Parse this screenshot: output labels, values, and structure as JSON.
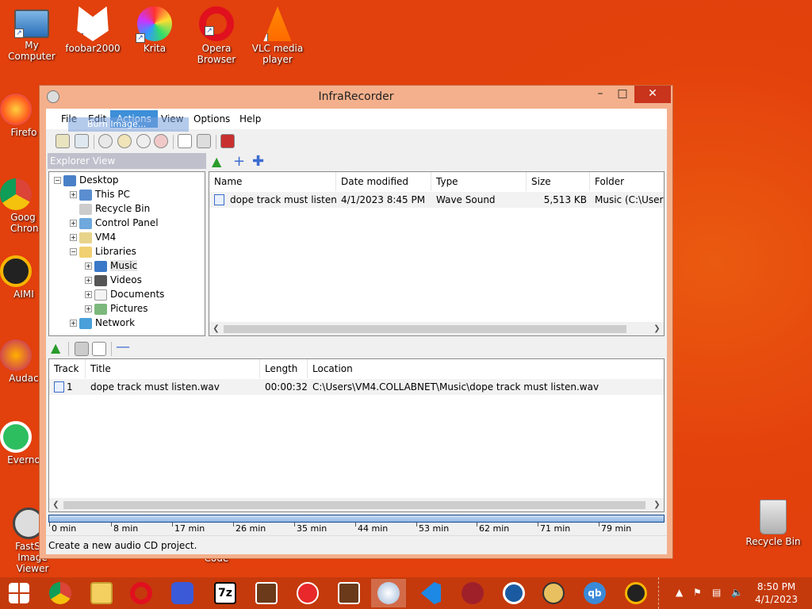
{
  "desktop": {
    "icons": [
      {
        "label": "My Computer"
      },
      {
        "label": "foobar2000"
      },
      {
        "label": "Krita"
      },
      {
        "label": "Opera Browser"
      },
      {
        "label": "VLC media player"
      },
      {
        "label": "Firefo"
      },
      {
        "label": "Goog Chron"
      },
      {
        "label": "AIMI"
      },
      {
        "label": "Audac"
      },
      {
        "label": "Everno"
      },
      {
        "label": "FastSto Image Viewer"
      },
      {
        "label": "Code"
      },
      {
        "label": "Recycle Bin"
      }
    ]
  },
  "window": {
    "title": "InfraRecorder",
    "controls": {
      "minimize": "–",
      "maximize": "□",
      "close": "✕"
    },
    "menu": [
      "File",
      "Edit",
      "Actions",
      "View",
      "Options",
      "Help"
    ],
    "active_menu": "Actions",
    "drag_label": "Burn Image...",
    "explorer_header": "Explorer View",
    "tree": [
      {
        "label": "Desktop",
        "icon": "desktop-icon"
      },
      {
        "label": "This PC",
        "icon": "computer-icon"
      },
      {
        "label": "Recycle Bin",
        "icon": "recycle-bin-icon"
      },
      {
        "label": "Control Panel",
        "icon": "control-panel-icon"
      },
      {
        "label": "VM4",
        "icon": "user-folder-icon"
      },
      {
        "label": "Libraries",
        "icon": "folder-icon"
      },
      {
        "label": "Music",
        "icon": "music-icon"
      },
      {
        "label": "Videos",
        "icon": "videos-icon"
      },
      {
        "label": "Documents",
        "icon": "documents-icon"
      },
      {
        "label": "Pictures",
        "icon": "pictures-icon"
      },
      {
        "label": "Network",
        "icon": "network-icon"
      }
    ],
    "files": {
      "columns": [
        "Name",
        "Date modified",
        "Type",
        "Size",
        "Folder"
      ],
      "rows": [
        {
          "name": "dope track must listen",
          "date": "4/1/2023 8:45 PM",
          "type": "Wave Sound",
          "size": "5,513 KB",
          "folder": "Music (C:\\Users\\"
        }
      ]
    },
    "tracks": {
      "columns": [
        "Track",
        "Title",
        "Length",
        "Location"
      ],
      "rows": [
        {
          "track": "1",
          "title": "dope track must listen.wav",
          "length": "00:00:32",
          "location": "C:\\Users\\VM4.COLLABNET\\Music\\dope track must listen.wav"
        }
      ]
    },
    "ruler_ticks": [
      "0 min",
      "8 min",
      "17 min",
      "26 min",
      "35 min",
      "44 min",
      "53 min",
      "62 min",
      "71 min",
      "79 min"
    ],
    "status": "Create a new audio CD project."
  },
  "taskbar": {
    "apps": [
      "start",
      "chrome",
      "file-explorer",
      "opera",
      "settings",
      "7zip",
      "321-player",
      "app-red",
      "321-player-2",
      "infrarecorder",
      "vscode",
      "app-32",
      "app-blue",
      "app-eye",
      "qbittorrent",
      "aimp"
    ],
    "time": "8:50 PM",
    "date": "4/1/2023"
  }
}
